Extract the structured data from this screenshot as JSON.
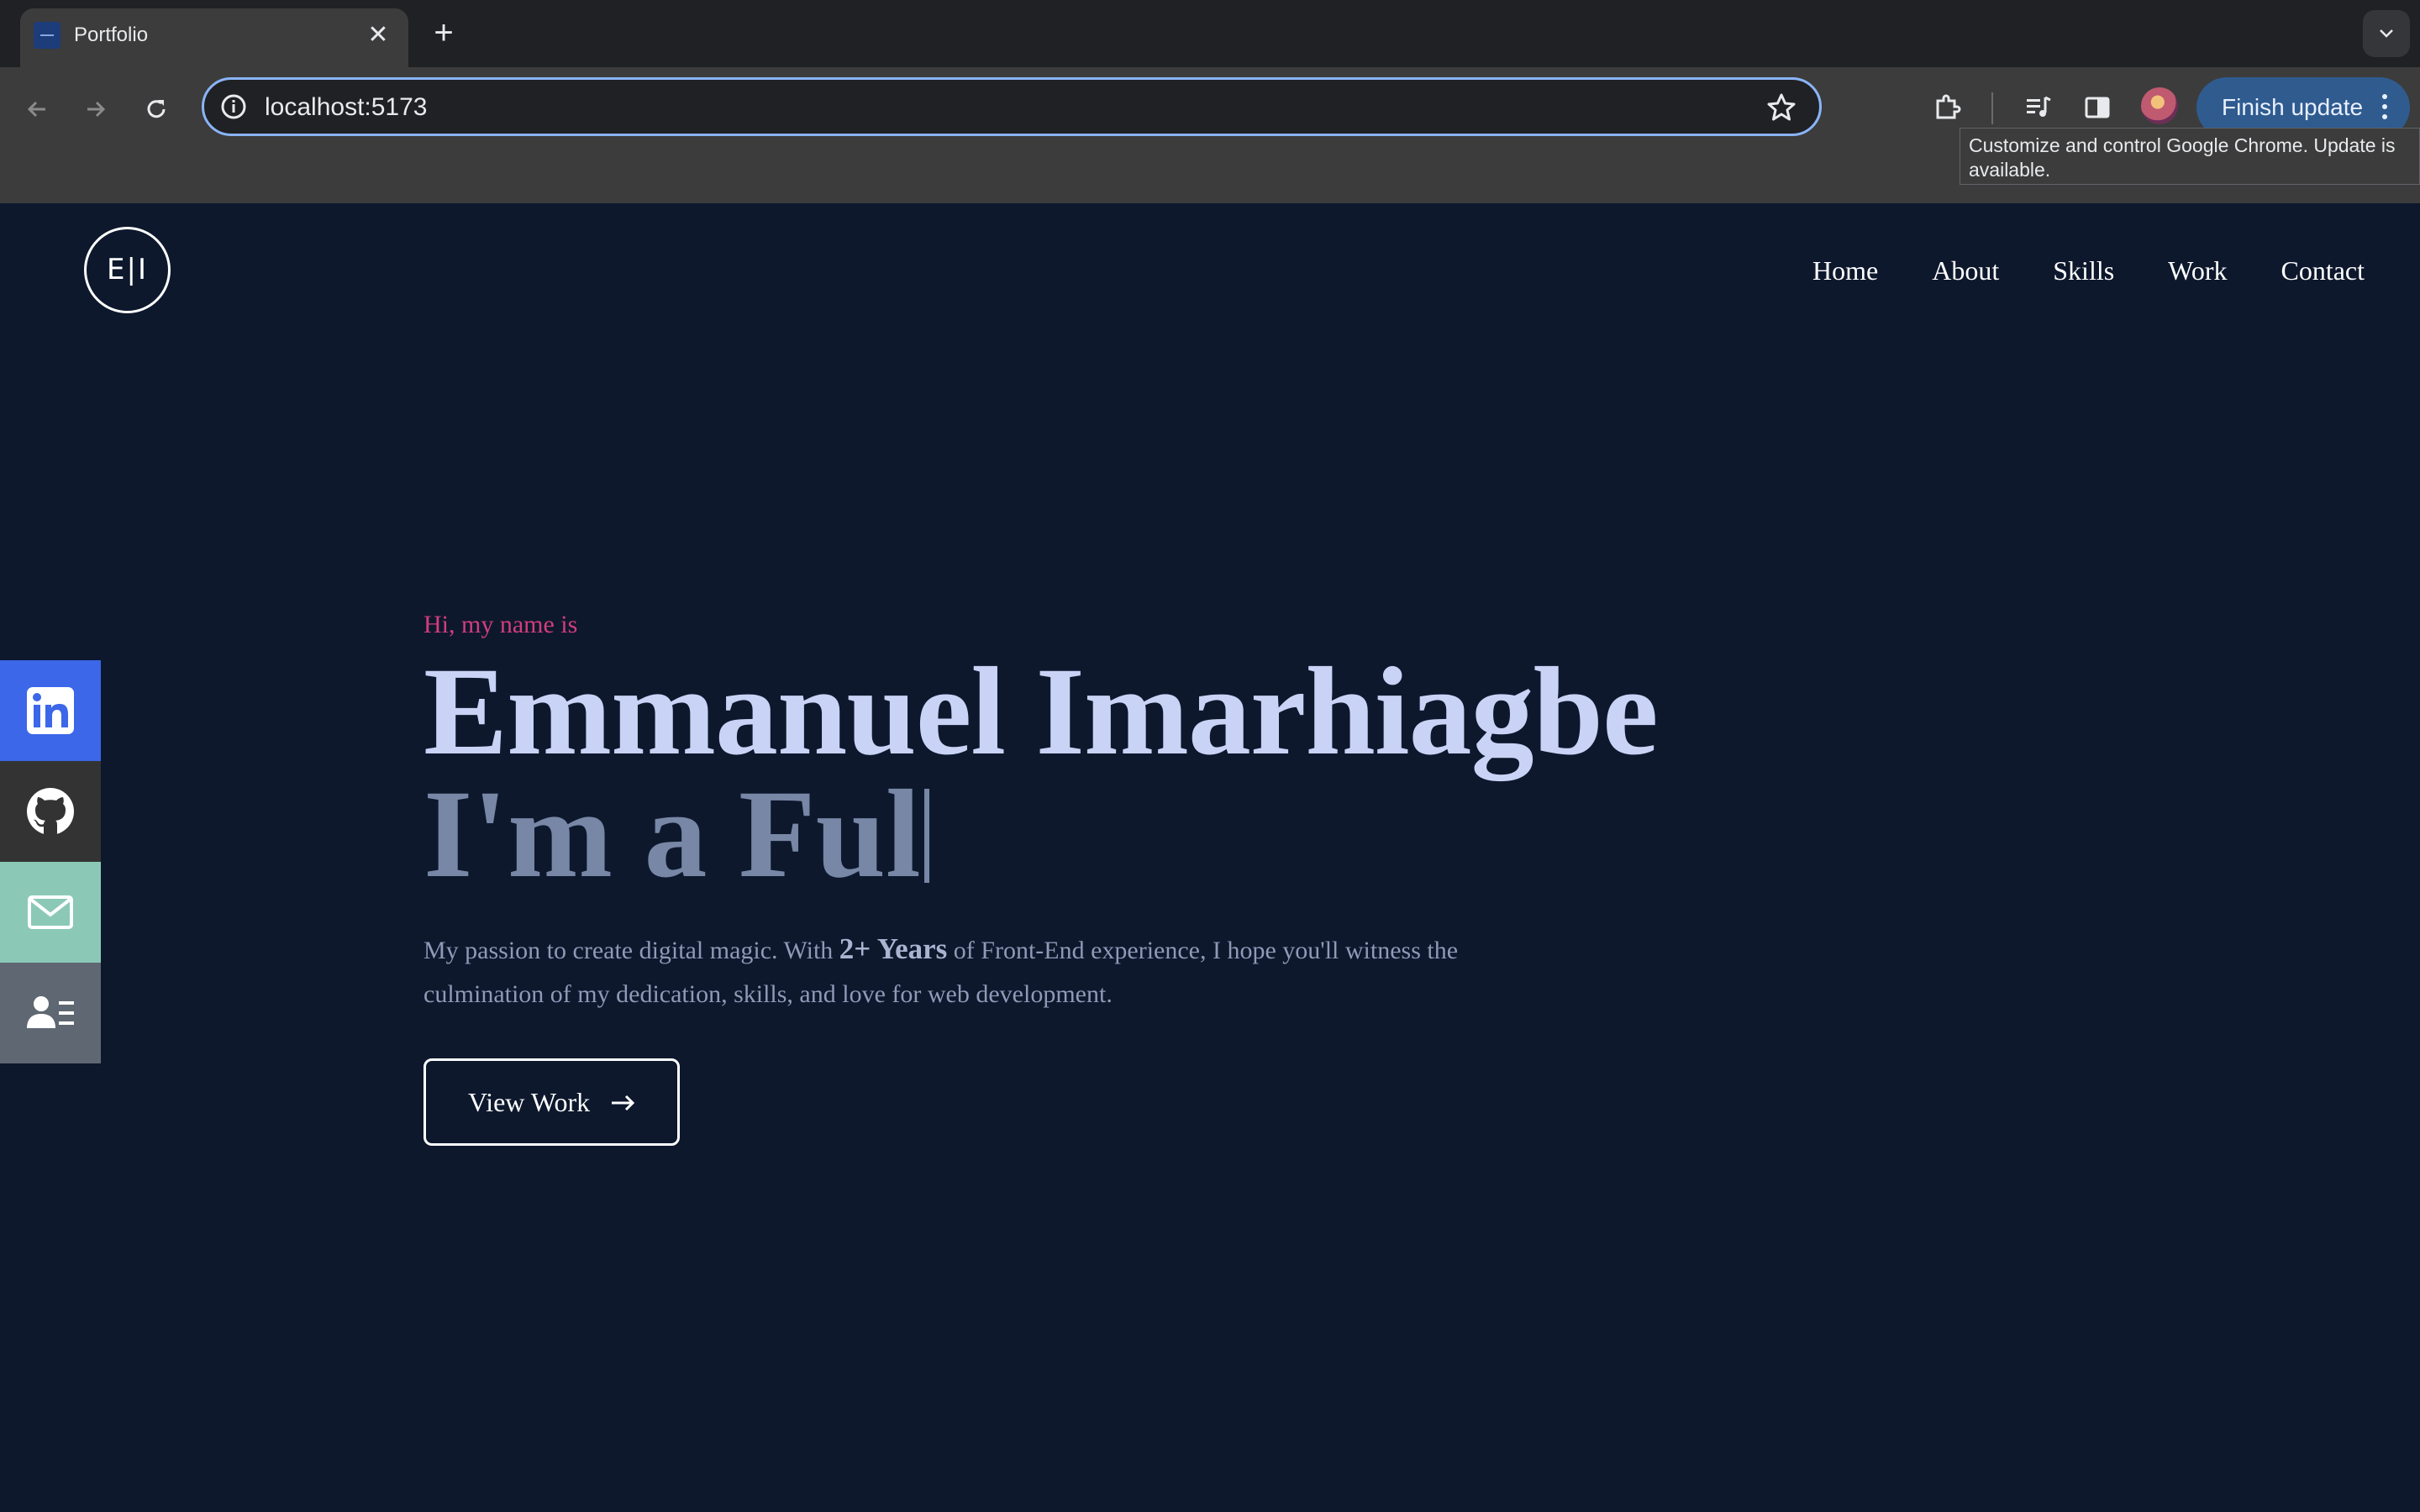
{
  "browser": {
    "tab_title": "Portfolio",
    "url": "localhost:5173",
    "finish_update_label": "Finish update",
    "tooltip": "Customize and control Google Chrome. Update is available."
  },
  "site": {
    "logo_text": "E|I",
    "nav": [
      "Home",
      "About",
      "Skills",
      "Work",
      "Contact"
    ],
    "social_links": [
      {
        "icon": "linkedin-icon",
        "color": "#3b67e8"
      },
      {
        "icon": "github-icon",
        "color": "#333333"
      },
      {
        "icon": "email-icon",
        "color": "#8bc9b6"
      },
      {
        "icon": "resume-icon",
        "color": "#5f6772"
      }
    ],
    "hero": {
      "greeting": "Hi, my name is",
      "name": "Emmanuel Imarhiagbe",
      "role_typed": "I'm a Ful",
      "description_before": "My passion to create digital magic. With ",
      "description_highlight": "2+ Years",
      "description_after": " of Front-End experience, I hope you'll witness the culmination of my dedication, skills, and love for web development.",
      "cta_label": "View Work"
    }
  },
  "colors": {
    "background": "#0d182d",
    "accent_pink": "#d33d7c",
    "name_color": "#c8d3f5",
    "role_color": "#7887a6"
  }
}
